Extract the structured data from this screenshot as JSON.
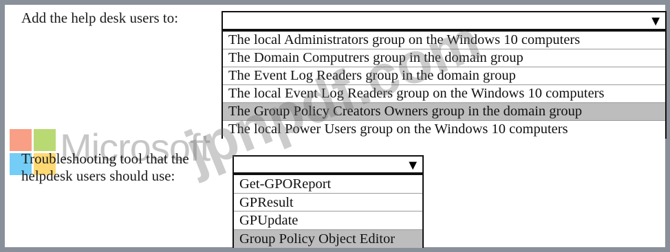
{
  "question1": {
    "label": "Add the help desk users to:",
    "selected": "",
    "arrow_icon": "dropdown-arrow-icon",
    "options": [
      "The local Administrators group on the Windows 10 computers",
      "The Domain Computrers group in the domain group",
      "The Event Log Readers group in the domain group",
      "The local Event Log Readers group on the Windows 10 computers",
      "The Group Policy Creators Owners group in the domain group",
      "The local Power Users group on the Windows 10 computers"
    ],
    "highlighted_index": 4
  },
  "question2": {
    "label": "Troubleshooting tool that the helpdesk users should use:",
    "selected": "",
    "arrow_icon": "dropdown-arrow-icon",
    "options": [
      "Get-GPOReport",
      "GPResult",
      "GPUpdate",
      "Group Policy Object Editor"
    ],
    "highlighted_index": 3
  },
  "watermark": {
    "brand": "Microsoft",
    "site": "jpnpdf.com",
    "colors": [
      "#f25022",
      "#7fba00",
      "#00a4ef",
      "#ffb900"
    ]
  }
}
